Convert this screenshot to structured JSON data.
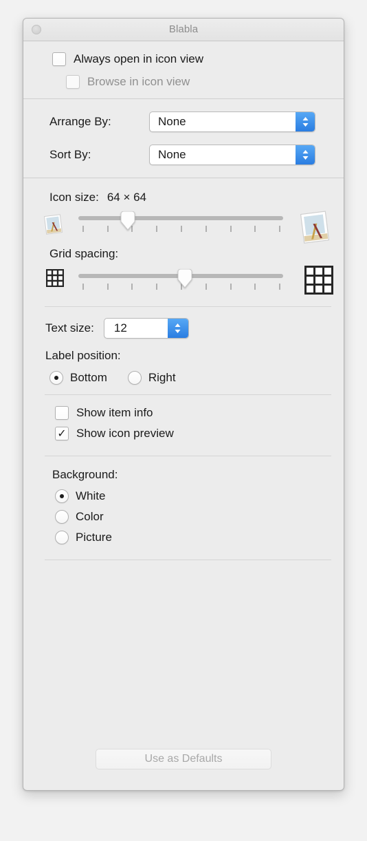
{
  "window": {
    "title": "Blabla",
    "close_button": "close-button"
  },
  "view_options": {
    "always_open_icon_view": {
      "label": "Always open in icon view",
      "checked": false,
      "enabled": true
    },
    "browse_icon_view": {
      "label": "Browse in icon view",
      "checked": false,
      "enabled": false
    },
    "arrange_by": {
      "label": "Arrange By:",
      "value": "None"
    },
    "sort_by": {
      "label": "Sort By:",
      "value": "None"
    },
    "icon_size": {
      "label": "Icon size:",
      "value": "64 × 64",
      "slider_percent": 24,
      "tick_count": 9,
      "min_icon": "small-document-icon",
      "max_icon": "large-document-icon"
    },
    "grid_spacing": {
      "label": "Grid spacing:",
      "slider_percent": 52,
      "tick_count": 9,
      "min_icon": "small-grid-icon",
      "max_icon": "large-grid-icon"
    },
    "text_size": {
      "label": "Text size:",
      "value": "12"
    },
    "label_position": {
      "label": "Label position:",
      "options": [
        {
          "label": "Bottom",
          "selected": true
        },
        {
          "label": "Right",
          "selected": false
        }
      ]
    },
    "show_item_info": {
      "label": "Show item info",
      "checked": false
    },
    "show_icon_preview": {
      "label": "Show icon preview",
      "checked": true,
      "check_glyph": "✓"
    },
    "background": {
      "label": "Background:",
      "options": [
        {
          "label": "White",
          "selected": true
        },
        {
          "label": "Color",
          "selected": false
        },
        {
          "label": "Picture",
          "selected": false
        }
      ]
    },
    "use_as_defaults": {
      "label": "Use as Defaults",
      "enabled": false
    }
  },
  "colors": {
    "accent_blue": "#2a7de1",
    "window_bg": "#ececec",
    "text": "#1a1a1a",
    "text_dim": "#909090"
  }
}
